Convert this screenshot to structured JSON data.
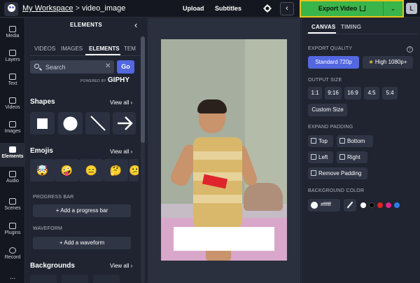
{
  "topbar": {
    "workspace": "My Workspace",
    "separator": ">",
    "project": "video_image",
    "upload": "Upload",
    "subtitles": "Subtitles",
    "export_label": "Export Video",
    "avatar_letter": "L",
    "accent": "#3ab54a",
    "highlight": "#e8c21a"
  },
  "rail": {
    "items": [
      {
        "label": "Media",
        "icon": "media-icon"
      },
      {
        "label": "Layers",
        "icon": "layers-icon"
      },
      {
        "label": "Text",
        "icon": "text-icon"
      },
      {
        "label": "Videos",
        "icon": "videos-icon"
      },
      {
        "label": "Images",
        "icon": "images-icon"
      },
      {
        "label": "Elements",
        "icon": "elements-icon",
        "active": true
      },
      {
        "label": "Audio",
        "icon": "audio-icon"
      },
      {
        "label": "Scenes",
        "icon": "scenes-icon"
      },
      {
        "label": "Plugins",
        "icon": "plugins-icon"
      },
      {
        "label": "Record",
        "icon": "record-icon"
      }
    ],
    "more": "..."
  },
  "elements_panel": {
    "title": "ELEMENTS",
    "tabs": [
      "VIDEOS",
      "IMAGES",
      "ELEMENTS",
      "TEM"
    ],
    "active_tab": "ELEMENTS",
    "search_placeholder": "Search",
    "go_label": "Go",
    "powered_by": "POWERED BY",
    "giphy": "GIPHY",
    "shapes_title": "Shapes",
    "view_all": "View all ›",
    "emojis_title": "Emojis",
    "emojis": [
      "🤯",
      "🤪",
      "😑",
      "🤔",
      "😕"
    ],
    "progress_title": "PROGRESS BAR",
    "progress_add": "+ Add a progress bar",
    "waveform_title": "WAVEFORM",
    "waveform_add": "+ Add a waveform",
    "backgrounds_title": "Backgrounds"
  },
  "right_panel": {
    "tabs": [
      "CANVAS",
      "TIMING"
    ],
    "active_tab": "CANVAS",
    "export_quality_label": "EXPORT QUALITY",
    "help": "?",
    "quality_standard": "Standard 720p",
    "quality_high": "High 1080p+",
    "star": "★",
    "output_size_label": "OUTPUT SIZE",
    "sizes": [
      "1:1",
      "9:16",
      "16:9",
      "4:5",
      "5:4"
    ],
    "custom_size": "Custom Size",
    "expand_padding_label": "EXPAND PADDING",
    "padding": {
      "top": "Top",
      "bottom": "Bottom",
      "left": "Left",
      "right": "Right",
      "remove": "Remove Padding"
    },
    "background_color_label": "BACKGROUND COLOR",
    "bg_value": "#ffffff",
    "swatches": [
      "#ffffff",
      "#000000",
      "#e02424",
      "#e0248a",
      "#2f7be8"
    ]
  }
}
